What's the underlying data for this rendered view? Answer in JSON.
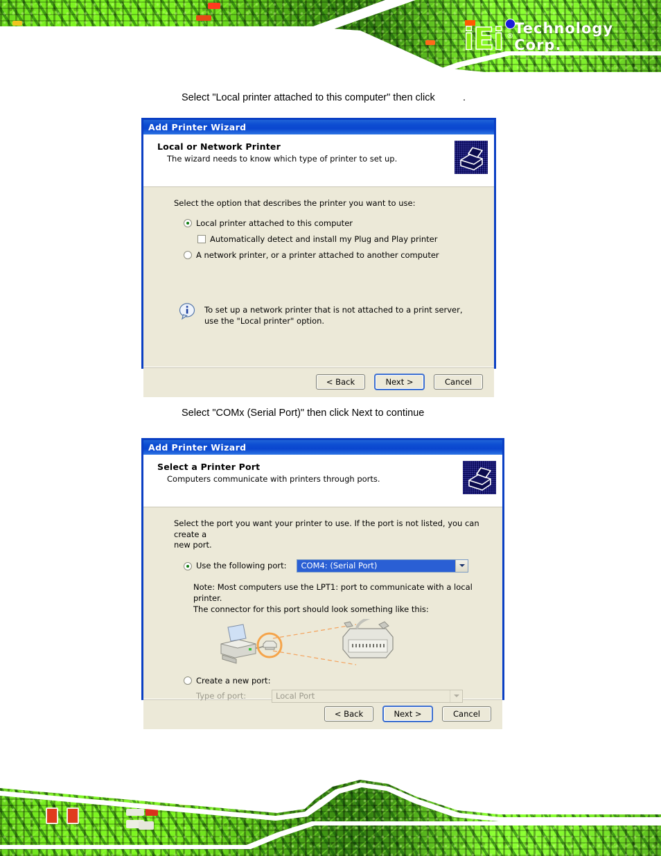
{
  "page": {
    "brand": {
      "logo_text": "iEi",
      "registered_mark": "®",
      "company": "Technology Corp.",
      "logo_green": "#8bf014",
      "logo_orange": "#ff5a00",
      "logo_blue": "#1a1ad8"
    },
    "captions": [
      "Select \"Local printer attached to this computer\" then click          .",
      "Select \"COMx (Serial Port)\" then click Next to continue"
    ]
  },
  "dialog1": {
    "title": "Add Printer Wizard",
    "header_title": "Local or Network Printer",
    "header_subtitle": "The wizard needs to know which type of printer to set up.",
    "icon": "printer-icon",
    "prompt": "Select the option that describes the printer you want to use:",
    "options": [
      {
        "label": "Local printer attached to this computer",
        "type": "radio",
        "selected": true
      },
      {
        "label": "Automatically detect and install my Plug and Play printer",
        "type": "checkbox",
        "checked": false
      },
      {
        "label": "A network printer, or a printer attached to another computer",
        "type": "radio",
        "selected": false
      }
    ],
    "info_line1": "To set up a network printer that is not attached to a print server,",
    "info_line2": "use the \"Local printer\" option.",
    "buttons": {
      "back": "< Back",
      "next": "Next >",
      "cancel": "Cancel"
    }
  },
  "dialog2": {
    "title": "Add Printer Wizard",
    "header_title": "Select a Printer Port",
    "header_subtitle": "Computers communicate with printers through ports.",
    "icon": "printer-icon",
    "prompt_line1": "Select the port you want your printer to use.  If the port is not listed, you can create a",
    "prompt_line2": "new port.",
    "use_following_port_label": "Use the following port:",
    "port_value": "COM4: (Serial Port)",
    "note_line1": "Note: Most computers use the LPT1: port to communicate with a local printer.",
    "note_line2": "The connector for this port should look something like this:",
    "create_new_port_label": "Create a new port:",
    "type_of_port_label": "Type of port:",
    "type_of_port_value": "Local Port",
    "buttons": {
      "back": "< Back",
      "next": "Next >",
      "cancel": "Cancel"
    }
  }
}
